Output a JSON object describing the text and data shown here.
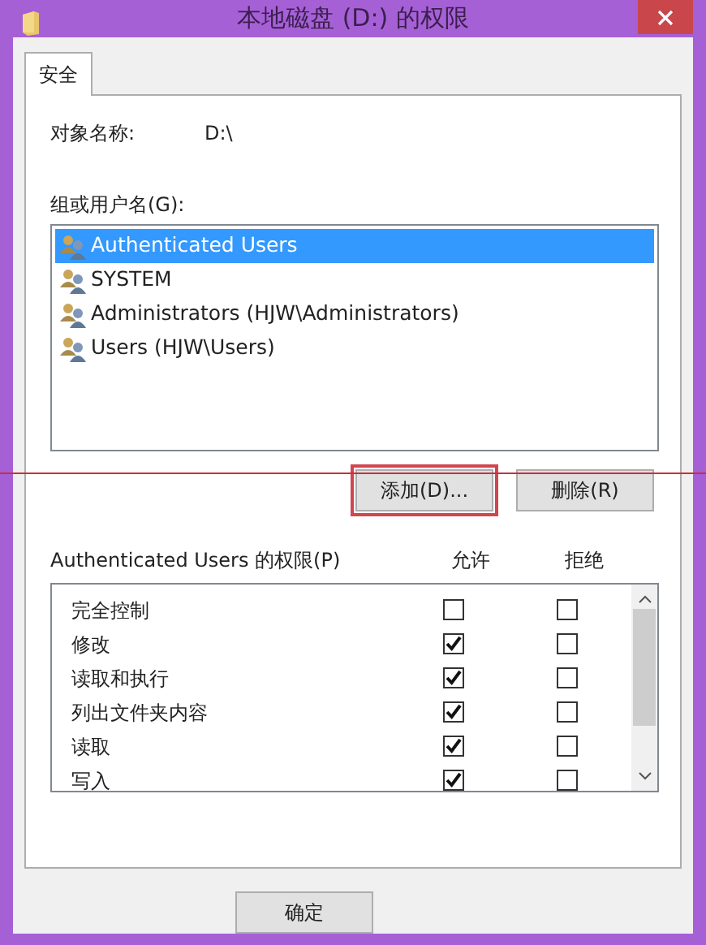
{
  "window": {
    "title": "本地磁盘 (D:) 的权限"
  },
  "tabs": [
    {
      "label": "安全",
      "selected": true
    }
  ],
  "object_name": {
    "label": "对象名称:",
    "value": "D:\\"
  },
  "groups": {
    "label": "组或用户名(G):",
    "items": [
      {
        "name": "Authenticated Users",
        "selected": true
      },
      {
        "name": "SYSTEM",
        "selected": false
      },
      {
        "name": "Administrators (HJW\\Administrators)",
        "selected": false
      },
      {
        "name": "Users (HJW\\Users)",
        "selected": false
      }
    ]
  },
  "group_buttons": [
    {
      "label": "添加(D)...",
      "highlighted": true
    },
    {
      "label": "删除(R)",
      "highlighted": false
    }
  ],
  "permissions": {
    "title": "Authenticated Users 的权限(P)",
    "columns": [
      "允许",
      "拒绝"
    ],
    "rows": [
      {
        "name": "完全控制",
        "allow": false,
        "deny": false
      },
      {
        "name": "修改",
        "allow": true,
        "deny": false
      },
      {
        "name": "读取和执行",
        "allow": true,
        "deny": false
      },
      {
        "name": "列出文件夹内容",
        "allow": true,
        "deny": false
      },
      {
        "name": "读取",
        "allow": true,
        "deny": false
      },
      {
        "name": "写入",
        "allow": true,
        "deny": false
      }
    ]
  },
  "footer_buttons": [
    {
      "label": "确定"
    }
  ]
}
